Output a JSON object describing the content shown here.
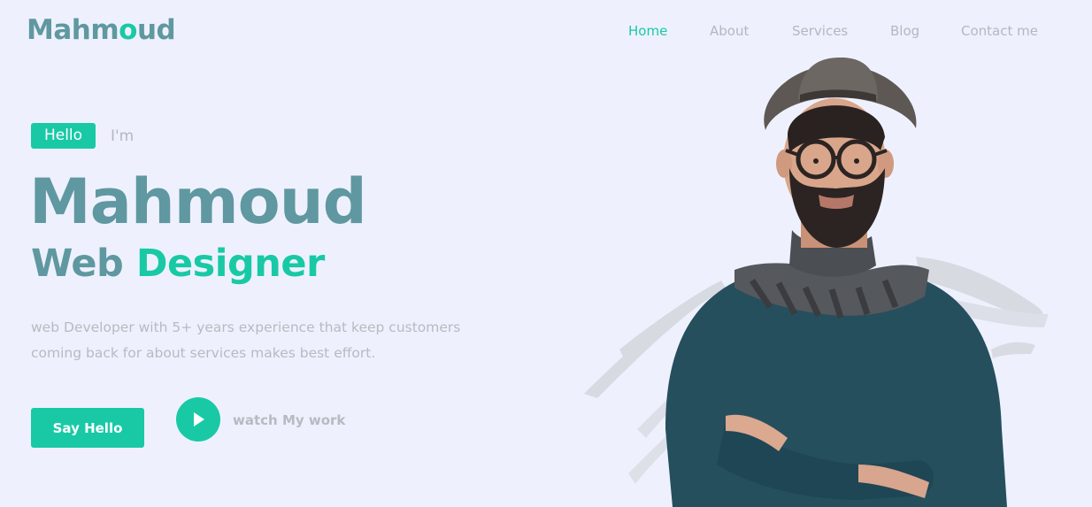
{
  "header": {
    "logo": {
      "main": "Mahm",
      "accent": "o",
      "tail": "ud"
    },
    "nav": [
      {
        "label": "Home",
        "active": true
      },
      {
        "label": "About",
        "active": false
      },
      {
        "label": "Services",
        "active": false
      },
      {
        "label": "Blog",
        "active": false
      },
      {
        "label": "Contact me",
        "active": false
      }
    ]
  },
  "hero": {
    "badge": "Hello",
    "intro": "I'm",
    "name": "Mahmoud",
    "role_first": "Web",
    "role_second": "Designer",
    "description_line1": "web Developer with 5+ years experience that keep customers",
    "description_line2": "coming back for about services makes best effort.",
    "primary_button": "Say Hello",
    "play_icon": "play-icon",
    "secondary_link": "watch My work"
  },
  "colors": {
    "accent": "#19c9a6",
    "brand_teal": "#5f98a0",
    "muted_text": "#b5b7bf",
    "background": "#eef1fd"
  }
}
